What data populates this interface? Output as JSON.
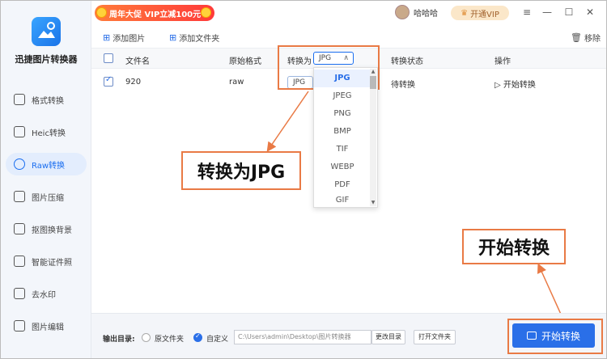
{
  "app": {
    "name": "迅捷图片转换器"
  },
  "sidebar": {
    "items": [
      {
        "label": "格式转换",
        "icon": "format-convert-icon"
      },
      {
        "label": "Heic转换",
        "icon": "heic-icon"
      },
      {
        "label": "Raw转换",
        "icon": "raw-icon",
        "active": true
      },
      {
        "label": "图片压缩",
        "icon": "compress-icon"
      },
      {
        "label": "抠图换背景",
        "icon": "cutout-icon"
      },
      {
        "label": "智能证件照",
        "icon": "id-photo-icon"
      },
      {
        "label": "去水印",
        "icon": "watermark-icon"
      },
      {
        "label": "图片编辑",
        "icon": "image-edit-icon"
      }
    ]
  },
  "topbar": {
    "promo": "周年大促 VIP立减100元",
    "username": "哈哈哈",
    "vip_button": "开通VIP",
    "window_controls": [
      "menu",
      "minimize",
      "maximize",
      "close"
    ]
  },
  "toolbar": {
    "add_image": "添加图片",
    "add_folder": "添加文件夹",
    "remove": "移除"
  },
  "table": {
    "headers": {
      "filename": "文件名",
      "original_format": "原始格式",
      "convert_to": "转换为",
      "status": "转换状态",
      "action": "操作"
    },
    "header_select_value": "JPG",
    "rows": [
      {
        "filename": "920",
        "format": "raw",
        "target": "JPG",
        "status": "待转换",
        "action": "开始转换"
      }
    ]
  },
  "dropdown": {
    "options": [
      "JPG",
      "JPEG",
      "PNG",
      "BMP",
      "TIF",
      "WEBP",
      "PDF",
      "GIF"
    ],
    "selected": "JPG"
  },
  "callouts": {
    "convert_to_jpg": "转换为JPG",
    "start_convert": "开始转换"
  },
  "bottom": {
    "output_label": "输出目录:",
    "option_original": "原文件夹",
    "option_custom": "自定义",
    "path": "C:\\Users\\admin\\Desktop\\图片转换器",
    "change_dir": "更改目录",
    "open_folder": "打开文件夹",
    "convert_button": "开始转换"
  },
  "colors": {
    "accent": "#2a6fe8",
    "highlight": "#e97a45",
    "promo": "#ff4a3a"
  }
}
